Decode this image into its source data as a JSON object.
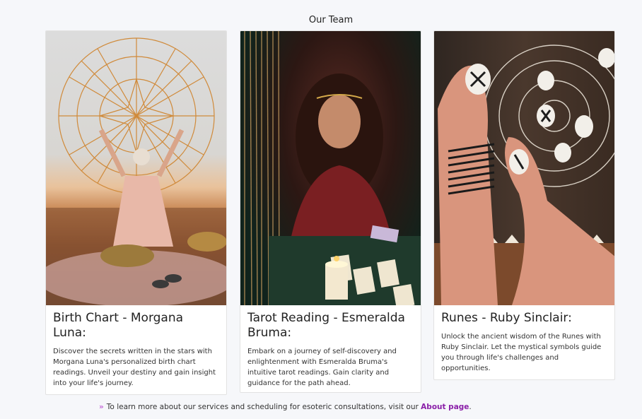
{
  "section": {
    "title": "Our Team"
  },
  "cards": [
    {
      "title": "Birth Chart - Morgana Luna:",
      "description": "Discover the secrets written in the stars with Morgana Luna's personalized birth chart readings. Unveil your destiny and gain insight into your life's journey."
    },
    {
      "title": "Tarot Reading - Esmeralda Bruma:",
      "description": "Embark on a journey of self-discovery and enlightenment with Esmeralda Bruma's intuitive tarot readings. Gain clarity and guidance for the path ahead."
    },
    {
      "title": "Runes - Ruby Sinclair:",
      "description": "Unlock the ancient wisdom of the Runes with Ruby Sinclair. Let the mystical symbols guide you through life's challenges and opportunities."
    }
  ],
  "footer": {
    "chevron": "»",
    "text": "To learn more about our services and scheduling for esoteric consultations, visit our ",
    "link_label": "About page",
    "suffix": "."
  }
}
